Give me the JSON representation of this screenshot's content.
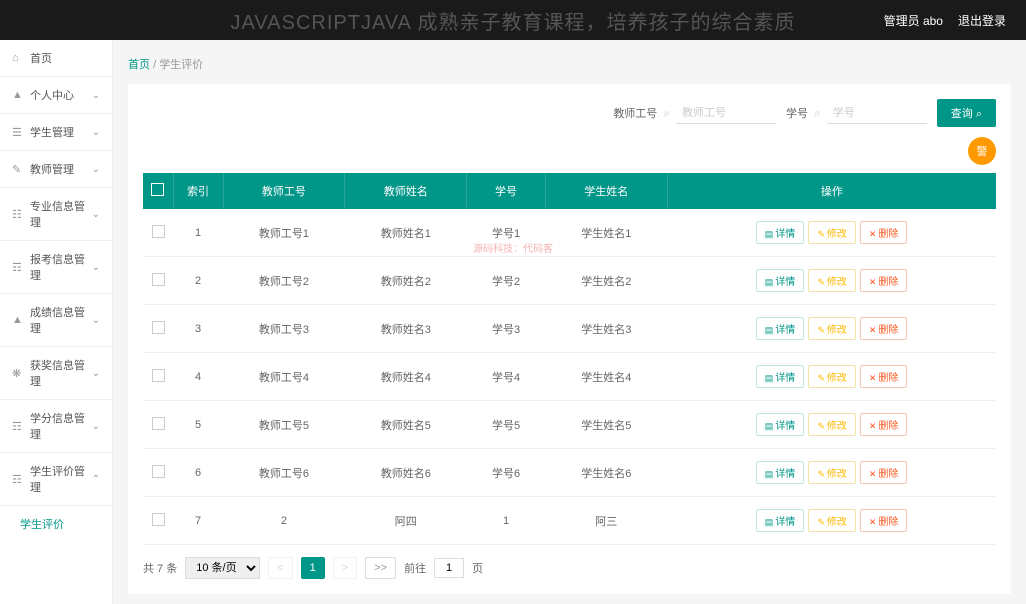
{
  "topbar": {
    "overlay_text": "JAVASCRIPTJAVA 成熟亲子教育课程，培养孩子的综合素质",
    "admin_label": "管理员 abo",
    "logout_label": "退出登录"
  },
  "sidebar": {
    "items": [
      {
        "icon": "⌂",
        "label": "首页",
        "arrow": ""
      },
      {
        "icon": "▲",
        "label": "个人中心",
        "arrow": "⌄"
      },
      {
        "icon": "☰",
        "label": "学生管理",
        "arrow": "⌄"
      },
      {
        "icon": "✎",
        "label": "教师管理",
        "arrow": "⌄"
      },
      {
        "icon": "☷",
        "label": "专业信息管理",
        "arrow": "⌄"
      },
      {
        "icon": "☶",
        "label": "报考信息管理",
        "arrow": "⌄"
      },
      {
        "icon": "▲",
        "label": "成绩信息管理",
        "arrow": "⌄"
      },
      {
        "icon": "❋",
        "label": "获奖信息管理",
        "arrow": "⌄"
      },
      {
        "icon": "☶",
        "label": "学分信息管理",
        "arrow": "⌄"
      },
      {
        "icon": "☶",
        "label": "学生评价管理",
        "arrow": "⌃"
      }
    ],
    "submenu": "学生评价"
  },
  "breadcrumb": {
    "home": "首页",
    "sep": "/",
    "current": "学生评价"
  },
  "filters": {
    "teacher_id_label": "教师工号",
    "teacher_id_placeholder": "教师工号",
    "student_id_label": "学号",
    "student_id_placeholder": "学号",
    "search_btn": "查询 ⌕",
    "warn_btn": "警"
  },
  "table": {
    "headers": [
      "",
      "索引",
      "教师工号",
      "教师姓名",
      "学号",
      "学生姓名",
      "操作"
    ],
    "rows": [
      {
        "idx": "1",
        "tid": "教师工号1",
        "tname": "教师姓名1",
        "sid": "学号1",
        "sname": "学生姓名1"
      },
      {
        "idx": "2",
        "tid": "教师工号2",
        "tname": "教师姓名2",
        "sid": "学号2",
        "sname": "学生姓名2"
      },
      {
        "idx": "3",
        "tid": "教师工号3",
        "tname": "教师姓名3",
        "sid": "学号3",
        "sname": "学生姓名3"
      },
      {
        "idx": "4",
        "tid": "教师工号4",
        "tname": "教师姓名4",
        "sid": "学号4",
        "sname": "学生姓名4"
      },
      {
        "idx": "5",
        "tid": "教师工号5",
        "tname": "教师姓名5",
        "sid": "学号5",
        "sname": "学生姓名5"
      },
      {
        "idx": "6",
        "tid": "教师工号6",
        "tname": "教师姓名6",
        "sid": "学号6",
        "sname": "学生姓名6"
      },
      {
        "idx": "7",
        "tid": "2",
        "tname": "阿四",
        "sid": "1",
        "sname": "阿三"
      }
    ],
    "ops": {
      "detail": "详情",
      "edit": "修改",
      "del": "删除"
    }
  },
  "pager": {
    "total": "共 7 条",
    "per_page": "10 条/页",
    "current": "1",
    "last": ">>",
    "goto": "前往",
    "page_suffix": "页",
    "goto_value": "1"
  },
  "watermark": "源码科技：代码客"
}
